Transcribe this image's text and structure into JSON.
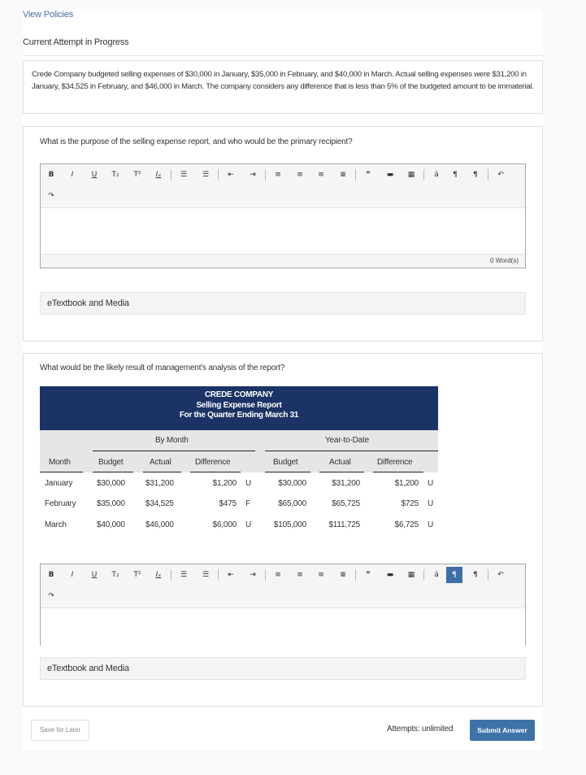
{
  "header": {
    "view_policies": "View Policies",
    "attempt_title": "Current Attempt in Progress"
  },
  "problem_text": "Crede Company budgeted selling expenses of $30,000 in January, $35,000 in February, and $40,000 in March. Actual selling expenses were $31,200 in January, $34,525 in February, and $46,000 in March. The company considers any difference that is less than 5% of the budgeted amount to be immaterial.",
  "toolbar": {
    "bold": "B",
    "italic": "I",
    "underline": "U",
    "subscript": "T₂",
    "superscript": "T²",
    "clear_format": "Iₓ",
    "bullet_list": "☰",
    "numbered_list": "☰",
    "outdent": "⇤",
    "indent": "⇥",
    "align_left": "≡",
    "align_center": "≡",
    "align_right": "≡",
    "justify": "≡",
    "blockquote": "”",
    "horizontal_rule": "▬",
    "table": "▦",
    "special_char": "á",
    "ltr": "¶",
    "rtl": "¶",
    "undo": "↶",
    "redo": "↷"
  },
  "question1": {
    "text": "What is the purpose of the selling expense report, and who would be the primary recipient?",
    "word_count": "0 Word(s)",
    "media_label": "eTextbook and Media"
  },
  "question2": {
    "text": "What would be the likely result of management's analysis of the report?",
    "media_label": "eTextbook and Media",
    "report": {
      "company": "CREDE COMPANY",
      "title": "Selling Expense Report",
      "period": "For the Quarter Ending March 31",
      "group_by_month": "By Month",
      "group_ytd": "Year-to-Date",
      "columns": [
        "Month",
        "Budget",
        "Actual",
        "Difference",
        "Budget",
        "Actual",
        "Difference"
      ],
      "rows": [
        {
          "month": "January",
          "budget": "$30,000",
          "actual": "$31,200",
          "diff": "$1,200",
          "diff_flag": "U",
          "ytd_budget": "$30,000",
          "ytd_actual": "$31,200",
          "ytd_diff": "$1,200",
          "ytd_flag": "U"
        },
        {
          "month": "February",
          "budget": "$35,000",
          "actual": "$34,525",
          "diff": "$475",
          "diff_flag": "F",
          "ytd_budget": "$65,000",
          "ytd_actual": "$65,725",
          "ytd_diff": "$725",
          "ytd_flag": "U"
        },
        {
          "month": "March",
          "budget": "$40,000",
          "actual": "$46,000",
          "diff": "$6,000",
          "diff_flag": "U",
          "ytd_budget": "$105,000",
          "ytd_actual": "$111,725",
          "ytd_diff": "$6,725",
          "ytd_flag": "U"
        }
      ]
    }
  },
  "footer": {
    "save_label": "Save for Later",
    "attempts_label": "Attempts: unlimited",
    "submit_label": "Submit Answer"
  },
  "colors": {
    "accent": "#3d72a8",
    "report_header": "#1b3365",
    "link": "#4a6da7"
  }
}
